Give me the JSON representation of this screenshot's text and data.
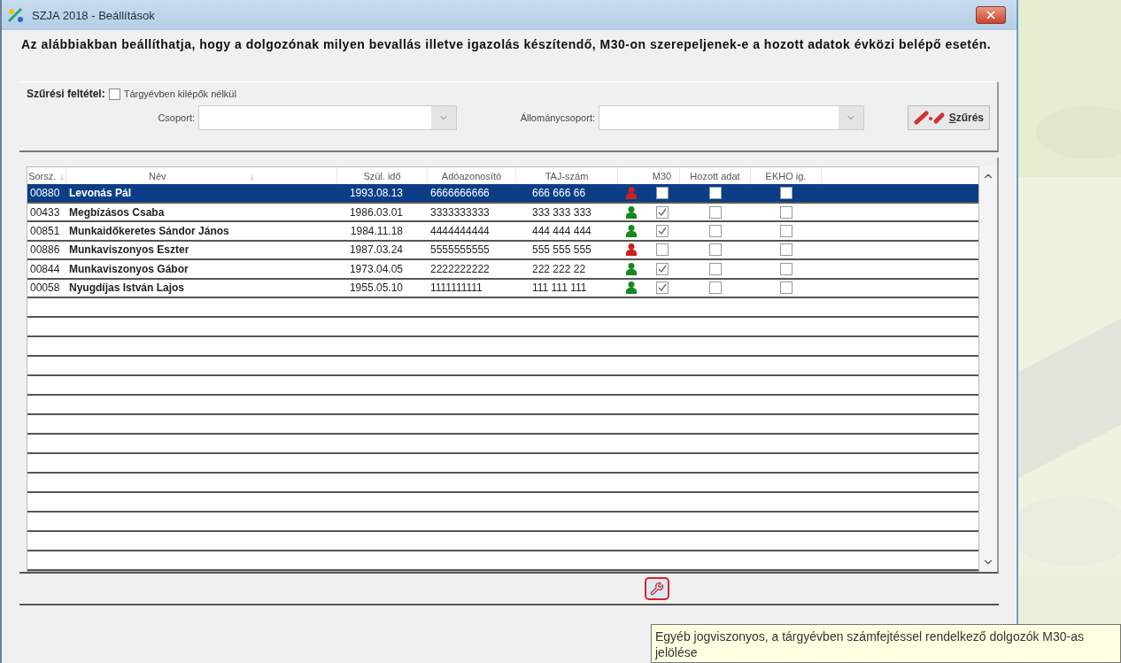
{
  "window": {
    "title": "SZJA 2018 - Beállítások"
  },
  "description": "Az alábbiakban beállíthatja, hogy a dolgozónak milyen bevallás illetve igazolás készítendő,  M30-on szerepeljenek-e a hozott adatok évközi belépő esetén.",
  "filter": {
    "label": "Szűrési feltétel:",
    "checkbox": {
      "label": "Tárgyévben kilépők nélkül",
      "checked": false
    },
    "group": {
      "label": "Csoport:"
    },
    "staff_group": {
      "label": "Állománycsoport:"
    },
    "button": {
      "label": "Szűrés"
    }
  },
  "table": {
    "columns": [
      {
        "label": "Sorsz.",
        "sort_mark": "↓"
      },
      {
        "label": "Név",
        "sort_mark": "↓"
      },
      {
        "label": "Szül. idő"
      },
      {
        "label": "Adóazonosító"
      },
      {
        "label": "TAJ-szám"
      },
      {
        "label": "M30"
      },
      {
        "label": "Hozott adat"
      },
      {
        "label": "EKHO ig."
      }
    ],
    "rows": [
      {
        "id": "00880",
        "name": "Levonás Pál",
        "birth": "1993.08.13",
        "tax_id": "6666666666",
        "taj": "666 666 66",
        "color": "#cc2020",
        "m30": false,
        "brought": false,
        "ekho": false,
        "selected": true
      },
      {
        "id": "00433",
        "name": "Megbízásos Csaba",
        "birth": "1986.03.01",
        "tax_id": "3333333333",
        "taj": "333 333 333",
        "color": "#138a1c",
        "m30": true,
        "brought": false,
        "ekho": false,
        "selected": false
      },
      {
        "id": "00851",
        "name": "Munkaidőkeretes Sándor János",
        "birth": "1984.11.18",
        "tax_id": "4444444444",
        "taj": "444 444 444",
        "color": "#138a1c",
        "m30": true,
        "brought": false,
        "ekho": false,
        "selected": false
      },
      {
        "id": "00886",
        "name": "Munkaviszonyos Eszter",
        "birth": "1987.03.24",
        "tax_id": "5555555555",
        "taj": "555 555 555",
        "color": "#cc2020",
        "m30": false,
        "brought": false,
        "ekho": false,
        "selected": false
      },
      {
        "id": "00844",
        "name": "Munkaviszonyos Gábor",
        "birth": "1973.04.05",
        "tax_id": "2222222222",
        "taj": "222 222 22",
        "color": "#138a1c",
        "m30": true,
        "brought": false,
        "ekho": false,
        "selected": false
      },
      {
        "id": "00058",
        "name": "Nyugdíjas István Lajos",
        "birth": "1955.05.10",
        "tax_id": "1111111111",
        "taj": "111 111 111",
        "color": "#138a1c",
        "m30": true,
        "brought": false,
        "ekho": false,
        "selected": false
      }
    ]
  },
  "tooltip": "Egyéb jogviszonyos, a tárgyévben számfejtéssel rendelkező dolgozók M30-as jelölése"
}
